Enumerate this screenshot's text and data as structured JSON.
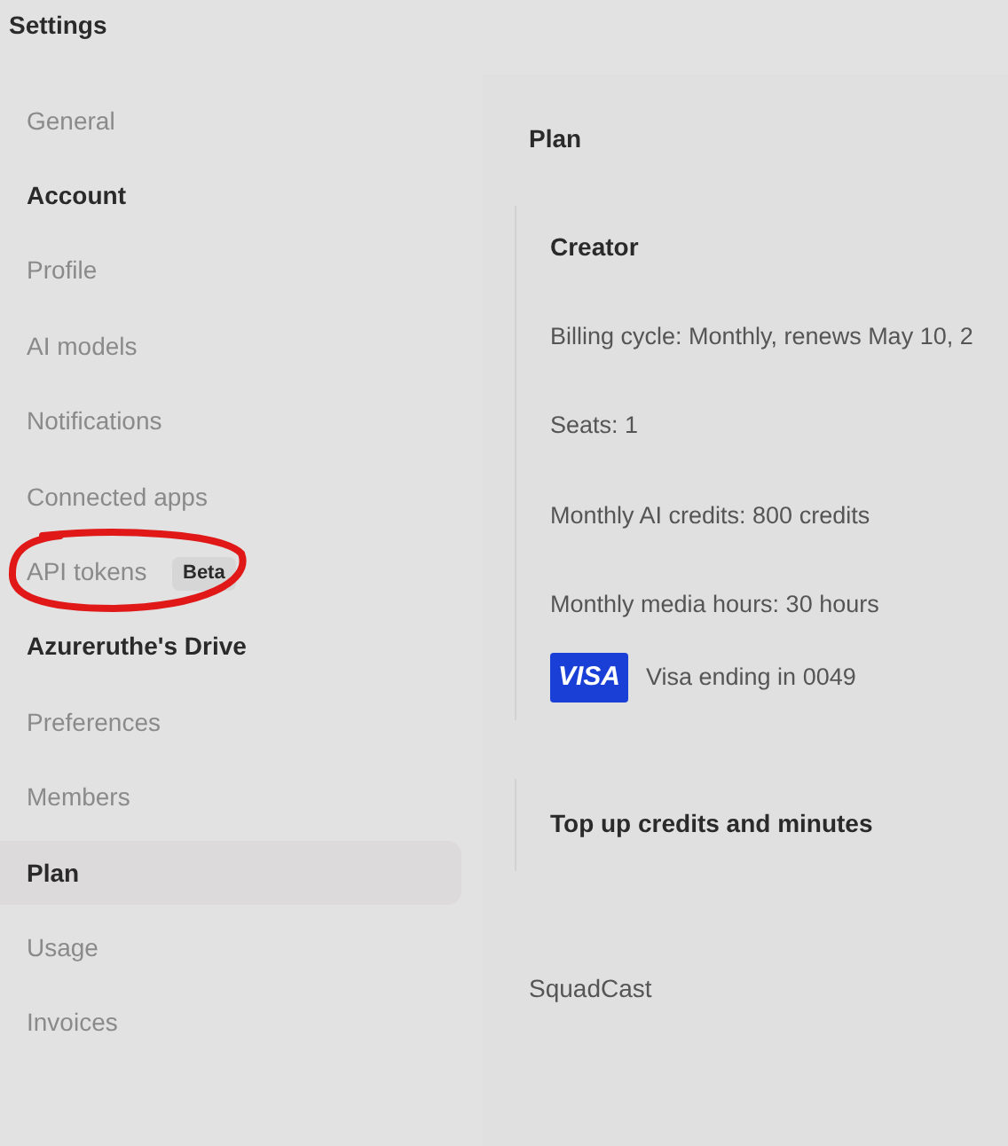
{
  "window": {
    "title": "Settings"
  },
  "sidebar": {
    "items": [
      {
        "kind": "link",
        "label": "General",
        "selected": false
      },
      {
        "kind": "heading",
        "label": "Account"
      },
      {
        "kind": "link",
        "label": "Profile",
        "selected": false
      },
      {
        "kind": "link",
        "label": "AI models",
        "selected": false
      },
      {
        "kind": "link",
        "label": "Notifications",
        "selected": false
      },
      {
        "kind": "link",
        "label": "Connected apps",
        "selected": false
      },
      {
        "kind": "link",
        "label": "API tokens",
        "badge": "Beta",
        "selected": false,
        "circled": true
      },
      {
        "kind": "heading",
        "label": "Azureruthe's Drive"
      },
      {
        "kind": "link",
        "label": "Preferences",
        "selected": false
      },
      {
        "kind": "link",
        "label": "Members",
        "selected": false
      },
      {
        "kind": "link",
        "label": "Plan",
        "selected": true
      },
      {
        "kind": "link",
        "label": "Usage",
        "selected": false
      },
      {
        "kind": "link",
        "label": "Invoices",
        "selected": false
      }
    ]
  },
  "main": {
    "title": "Plan",
    "plan_card": {
      "name": "Creator",
      "details": [
        "Billing cycle: Monthly, renews May 10, 2",
        "Seats: 1",
        "Monthly AI credits: 800 credits",
        "Monthly media hours: 30 hours"
      ],
      "card": {
        "brand": "VISA",
        "label": "Visa ending in 0049"
      }
    },
    "topup_card": {
      "title": "Top up credits and minutes"
    },
    "footer": "SquadCast"
  }
}
